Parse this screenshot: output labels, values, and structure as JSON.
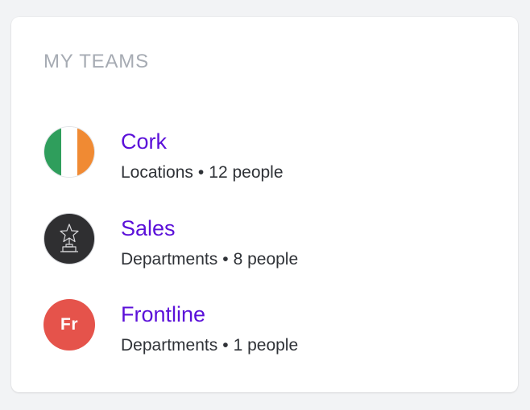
{
  "panel": {
    "title": "MY TEAMS"
  },
  "teams": [
    {
      "name": "Cork",
      "type": "Locations",
      "separator": "•",
      "count": "12 people",
      "avatar": {
        "kind": "flag",
        "icon": "ireland-flag-icon",
        "colors": [
          "#2f9e5c",
          "#ffffff",
          "#f08a33"
        ]
      }
    },
    {
      "name": "Sales",
      "type": "Departments",
      "separator": "•",
      "count": "8 people",
      "avatar": {
        "kind": "icon",
        "icon": "trophy-icon",
        "color": "#2f2f31"
      }
    },
    {
      "name": "Frontline",
      "type": "Departments",
      "separator": "•",
      "count": "1 people",
      "avatar": {
        "kind": "initials",
        "initials": "Fr",
        "color": "#e5534b"
      }
    }
  ],
  "colors": {
    "accent": "#5b10d9",
    "title_gray": "#a6abb3",
    "text_dark": "#2f3237",
    "background": "#f2f3f5"
  }
}
